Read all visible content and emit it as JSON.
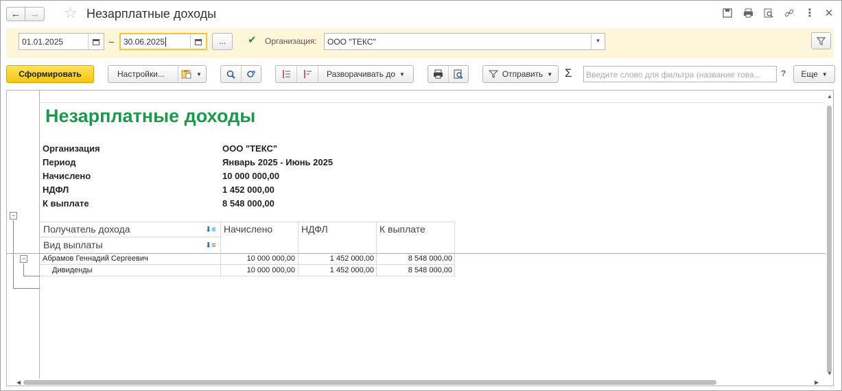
{
  "window": {
    "title": "Незарплатные доходы",
    "nav": {
      "back": "←",
      "forward": "→"
    },
    "icons": [
      "save-icon",
      "print-icon",
      "preview-icon",
      "link-icon",
      "more-icon",
      "close-icon"
    ]
  },
  "filters": {
    "date_from": "01.01.2025",
    "date_separator": "–",
    "date_to": "30.06.2025",
    "period_button": "...",
    "org_checked": true,
    "org_label": "Организация:",
    "org_value": "ООО \"ТЕКС\""
  },
  "toolbar": {
    "generate": "Сформировать",
    "settings": "Настройки...",
    "expand_to": "Разворачивать до",
    "send": "Отправить",
    "sigma": "Σ",
    "search_placeholder": "Введите слово для фильтра (название това...",
    "help": "?",
    "more": "Еще"
  },
  "report": {
    "title": "Незарплатные доходы",
    "header": [
      {
        "label": "Организация",
        "value": "ООО \"ТЕКС\""
      },
      {
        "label": "Период",
        "value": "Январь 2025 - Июнь 2025"
      },
      {
        "label": "Начислено",
        "value": "10 000 000,00"
      },
      {
        "label": "НДФЛ",
        "value": "1 452 000,00"
      },
      {
        "label": "К выплате",
        "value": "8 548 000,00"
      }
    ],
    "columns": {
      "recipient": "Получатель дохода",
      "payment_type": "Вид выплаты",
      "accrued": "Начислено",
      "ndfl": "НДФЛ",
      "to_pay": "К выплате"
    },
    "rows": [
      {
        "name": "Абрамов Геннадий Сергеевич",
        "accrued": "10 000 000,00",
        "ndfl": "1 452 000,00",
        "to_pay": "8 548 000,00"
      },
      {
        "name": "Дивиденды",
        "accrued": "10 000 000,00",
        "ndfl": "1 452 000,00",
        "to_pay": "8 548 000,00"
      }
    ]
  },
  "colors": {
    "accent_title": "#1a9a4a",
    "primary_button": "#f4c410",
    "filter_bg": "#fdf6d8"
  }
}
